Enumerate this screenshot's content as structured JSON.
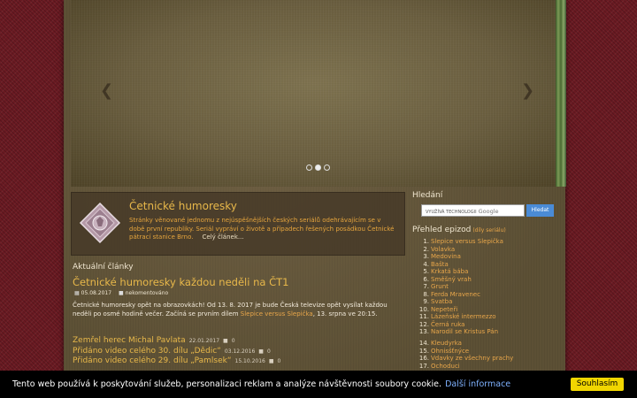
{
  "hero": {
    "title": "Četnické humoresky",
    "description": "Stránky věnované jednomu z nejúspěšnějších českých seriálů odehrávajícím se v době první republiky. Seriál vypráví o životě a případech řešených posádkou Četnické pátrací stanice Brno.",
    "more_link": "Celý článek..."
  },
  "articles": {
    "heading": "Aktuální články",
    "featured": {
      "title": "Četnické humoresky každou neděli na ČT1",
      "date": "05.08.2017",
      "comments": "nekomentováno",
      "body_before": "Četnické humoresky opět na obrazovkách! Od 13. 8. 2017 je bude Česká televize opět vysílat každou neděli po osmé hodině večer. Začíná se prvním dílem ",
      "body_link": "Slepice versus Slepička",
      "body_after": ", 13. srpna ve 20:15."
    },
    "older": [
      {
        "title": "Zemřel herec Michal Pavlata",
        "date": "22.01.2017",
        "comments": "0"
      },
      {
        "title": "Přidáno video celého 30. dílu „Dědic“",
        "date": "03.12.2016",
        "comments": "0"
      },
      {
        "title": "Přidáno video celého 29. dílu „Pamlsek“",
        "date": "15.10.2016",
        "comments": "0"
      }
    ]
  },
  "sidebar": {
    "search_title": "Hledání",
    "search_placeholder": "VYUŽÍVÁ TECHNOLOGII",
    "google_label": "Google",
    "search_button": "Hledat",
    "episodes_title": "Přehled epizod",
    "episodes_sub": "(díly seriálu)",
    "episodes": [
      {
        "n": "1.",
        "t": "Slepice versus Slepička"
      },
      {
        "n": "2.",
        "t": "Volavka"
      },
      {
        "n": "3.",
        "t": "Medovina"
      },
      {
        "n": "4.",
        "t": "Bašta"
      },
      {
        "n": "5.",
        "t": "Krkatá bába"
      },
      {
        "n": "6.",
        "t": "Směšný vrah"
      },
      {
        "n": "7.",
        "t": "Grunt"
      },
      {
        "n": "8.",
        "t": "Ferda Mravenec"
      },
      {
        "n": "9.",
        "t": "Svatba"
      },
      {
        "n": "10.",
        "t": "Nepeteři"
      },
      {
        "n": "11.",
        "t": "Lázeňské intermezzo"
      },
      {
        "n": "12.",
        "t": "Černá ruka"
      },
      {
        "n": "13.",
        "t": "Narodil se Kristus Pán"
      }
    ],
    "episodes_2": [
      {
        "n": "14.",
        "t": "Kleudyrka"
      },
      {
        "n": "15.",
        "t": "Ohnisšťnýce"
      },
      {
        "n": "16.",
        "t": "Vdavky ze všechny prachy"
      },
      {
        "n": "17.",
        "t": "Ochoduci"
      }
    ]
  },
  "cookie": {
    "text": "Tento web používá k poskytování služeb, personalizaci reklam a analýze návštěvnosti soubory cookie.",
    "link": "Další informace",
    "button": "Souhlasím"
  },
  "icons": {
    "prev": "chevron-left-icon",
    "next": "chevron-right-icon",
    "calendar": "calendar-icon",
    "comment": "comment-icon"
  }
}
